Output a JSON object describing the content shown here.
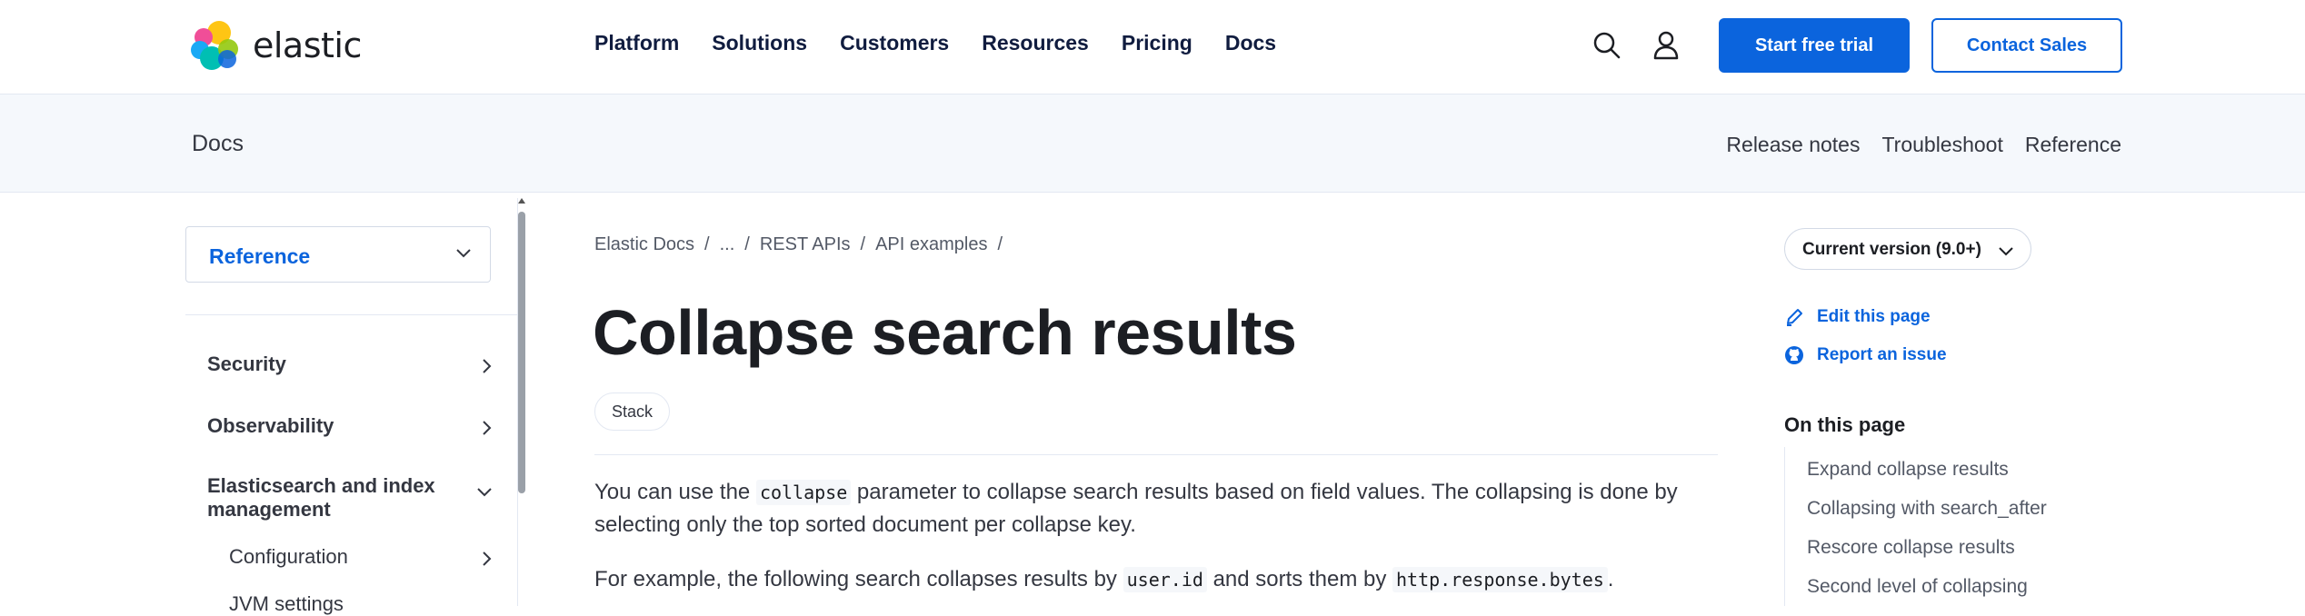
{
  "header": {
    "brand": "elastic",
    "nav": [
      "Platform",
      "Solutions",
      "Customers",
      "Resources",
      "Pricing",
      "Docs"
    ],
    "search_icon": "search-icon",
    "user_icon": "user-icon",
    "trial_button": "Start free trial",
    "sales_button": "Contact Sales"
  },
  "docs_bar": {
    "title": "Docs",
    "links": [
      "Release notes",
      "Troubleshoot",
      "Reference"
    ]
  },
  "sidebar": {
    "selector": "Reference",
    "items": [
      {
        "label": "Security"
      },
      {
        "label": "Observability"
      },
      {
        "label": "Elasticsearch and index management"
      }
    ],
    "subitems": [
      {
        "label": "Configuration"
      },
      {
        "label": "JVM settings"
      }
    ]
  },
  "main": {
    "breadcrumb": [
      "Elastic Docs",
      "...",
      "REST APIs",
      "API examples"
    ],
    "title": "Collapse search results",
    "badge": "Stack",
    "para1": {
      "pre": "You can use the ",
      "code": "collapse",
      "post": " parameter to collapse search results based on field values. The collapsing is done by selecting only the top sorted document per collapse key."
    },
    "para2": {
      "pre": "For example, the following search collapses results by ",
      "code1": "user.id",
      "mid": " and sorts them by ",
      "code2": "http.response.bytes",
      "post": "."
    }
  },
  "right": {
    "version": "Current version (9.0+)",
    "edit": "Edit this page",
    "issue": "Report an issue",
    "toc_title": "On this page",
    "toc": [
      "Expand collapse results",
      "Collapsing with search_after",
      "Rescore collapse results",
      "Second level of collapsing"
    ]
  },
  "colors": {
    "accent": "#0b64dd",
    "text": "#1c1e23",
    "docs_bar_bg": "#f5f8fc"
  }
}
